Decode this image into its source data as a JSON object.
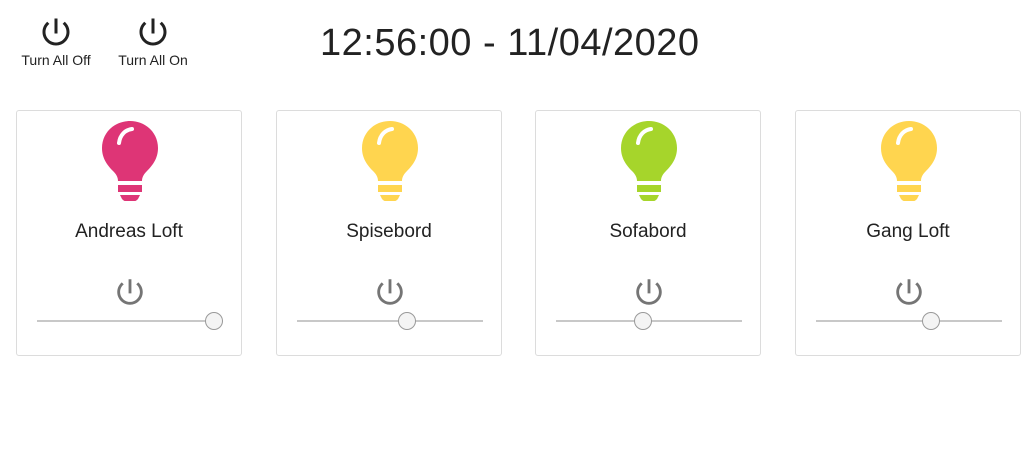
{
  "header": {
    "turn_all_off_label": "Turn All Off",
    "turn_all_on_label": "Turn All On",
    "clock": "12:56:00 - 11/04/2020"
  },
  "lights": [
    {
      "name": "Andreas Loft",
      "bulb_color": "#DE3576",
      "brightness": 0.95,
      "power_icon": "power-icon"
    },
    {
      "name": "Spisebord",
      "bulb_color": "#FFD54F",
      "brightness": 0.59,
      "power_icon": "power-icon"
    },
    {
      "name": "Sofabord",
      "bulb_color": "#A6D52B",
      "brightness": 0.47,
      "power_icon": "power-icon"
    },
    {
      "name": "Gang Loft",
      "bulb_color": "#FFD54F",
      "brightness": 0.62,
      "power_icon": "power-icon"
    }
  ],
  "colors": {
    "icon_dark": "#222222",
    "icon_grey": "#757575"
  }
}
